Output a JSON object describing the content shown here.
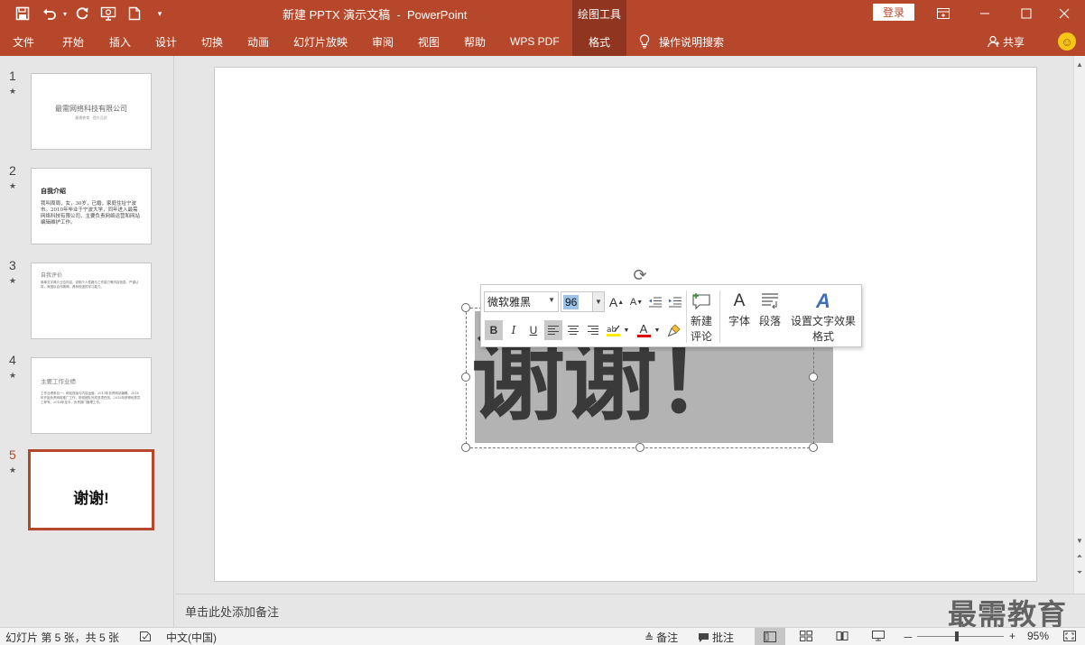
{
  "window": {
    "title": "新建 PPTX 演示文稿  -  PowerPoint",
    "context_tool": "绘图工具",
    "login": "登录"
  },
  "quick_access": {
    "save_icon": "save-icon",
    "undo_icon": "undo-icon",
    "redo_icon": "redo-icon",
    "slideshow_icon": "slideshow-icon",
    "new_icon": "new-file-icon"
  },
  "ribbon": {
    "tabs": [
      "文件",
      "开始",
      "插入",
      "设计",
      "切换",
      "动画",
      "幻灯片放映",
      "审阅",
      "视图",
      "帮助",
      "WPS PDF",
      "格式"
    ],
    "active_tab": "格式",
    "tell_me": "操作说明搜索",
    "share": "共享"
  },
  "thumbnails": [
    {
      "number": "1",
      "star": "★",
      "title": "最需网络科技有限公司",
      "subtitle": "最需教育 · 提升品质"
    },
    {
      "number": "2",
      "star": "★",
      "title": "自我介绍",
      "body": "我叫周周，女，30岁，已婚，家庭住址宁波市。2010年毕业于宁波大学，同年进入最需网络科技有限公司，主要负责网络运营和网站编辑维护工作。"
    },
    {
      "number": "3",
      "star": "★",
      "title": "自我评价",
      "body": "简单文字简介占位内容，说明个人性格与工作能力等内容信息。严谨认真，有团队合作精神。具有较强的学习能力。"
    },
    {
      "number": "4",
      "star": "★",
      "title": "主要工作业绩",
      "body": "工作业绩条目一：网站改版与内容运营。2013年负责网站编辑。2014年开始负责网络推广工作，带领团队完成多项任务。2015年获得优秀员工称号。2016年至今，负责部门管理工作。"
    },
    {
      "number": "5",
      "star": "★",
      "title": "谢谢!"
    }
  ],
  "slide": {
    "text": "谢谢！"
  },
  "mini_toolbar": {
    "font_name": "微软雅黑",
    "font_size": "96",
    "grow_font": "A",
    "shrink_font": "A",
    "bold": "B",
    "italic": "I",
    "underline": "U",
    "font_color_letter": "A",
    "new_comment": "新建\n评论",
    "new_comment_l1": "新建",
    "new_comment_l2": "评论",
    "font_label": "字体",
    "paragraph_label": "段落",
    "text_effect_l1": "设置文字效果",
    "text_effect_l2": "格式",
    "font_glyph": "A",
    "effect_glyph": "A"
  },
  "notes": {
    "placeholder": "单击此处添加备注"
  },
  "watermark": "最需教育",
  "status_bar": {
    "slide_info": "幻灯片 第 5 张，共 5 张",
    "language": "中文(中国)",
    "notes": "备注",
    "comments": "批注",
    "zoom_minus": "－",
    "zoom_plus": "+",
    "zoom": "95%"
  },
  "colors": {
    "accent": "#b7472a",
    "accent_dark": "#8f3520",
    "selection": "#9cc3e5"
  }
}
